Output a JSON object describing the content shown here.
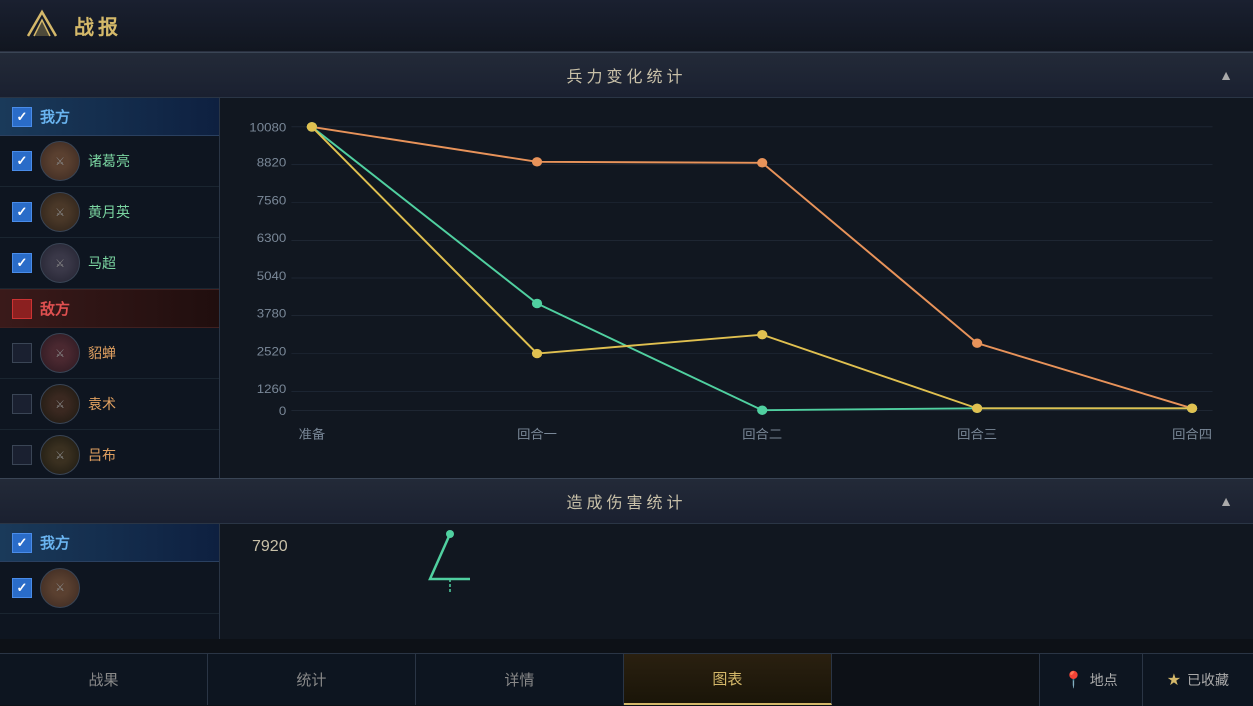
{
  "header": {
    "title": "战报",
    "logo_alt": "game-logo"
  },
  "section1": {
    "title": "兵力变化统计",
    "collapse": "▲"
  },
  "section2": {
    "title": "造成伤害统计",
    "collapse": "▲"
  },
  "left_panel": {
    "my_side_label": "我方",
    "enemy_side_label": "敌方",
    "heroes_my": [
      {
        "name": "诸葛亮",
        "id": "zhuge",
        "checked": true
      },
      {
        "name": "黄月英",
        "id": "huang",
        "checked": true
      },
      {
        "name": "马超",
        "id": "ma",
        "checked": true
      }
    ],
    "heroes_enemy": [
      {
        "name": "貂蝉",
        "id": "diao",
        "checked": false
      },
      {
        "name": "袁术",
        "id": "yuan",
        "checked": false
      },
      {
        "name": "吕布",
        "id": "lv",
        "checked": false
      }
    ]
  },
  "chart": {
    "y_labels": [
      "0",
      "1260",
      "2520",
      "3780",
      "5040",
      "6300",
      "7560",
      "8820",
      "10080"
    ],
    "x_labels": [
      "准备",
      "回合一",
      "回合二",
      "回合三",
      "回合四"
    ],
    "colors": {
      "orange": "#e8935a",
      "green": "#50d0a0",
      "yellow": "#e0c050"
    },
    "series_orange": [
      10080,
      8820,
      8790,
      2400,
      80
    ],
    "series_green": [
      10080,
      3780,
      0,
      80,
      80
    ],
    "series_yellow": [
      10080,
      2000,
      2700,
      80,
      80
    ]
  },
  "damage": {
    "value": "7920"
  },
  "tabs": [
    {
      "label": "战果",
      "active": false
    },
    {
      "label": "统计",
      "active": false
    },
    {
      "label": "详情",
      "active": false
    },
    {
      "label": "图表",
      "active": true
    }
  ],
  "buttons": [
    {
      "label": "地点",
      "icon": "📍"
    },
    {
      "label": "已收藏",
      "icon": "★"
    }
  ]
}
